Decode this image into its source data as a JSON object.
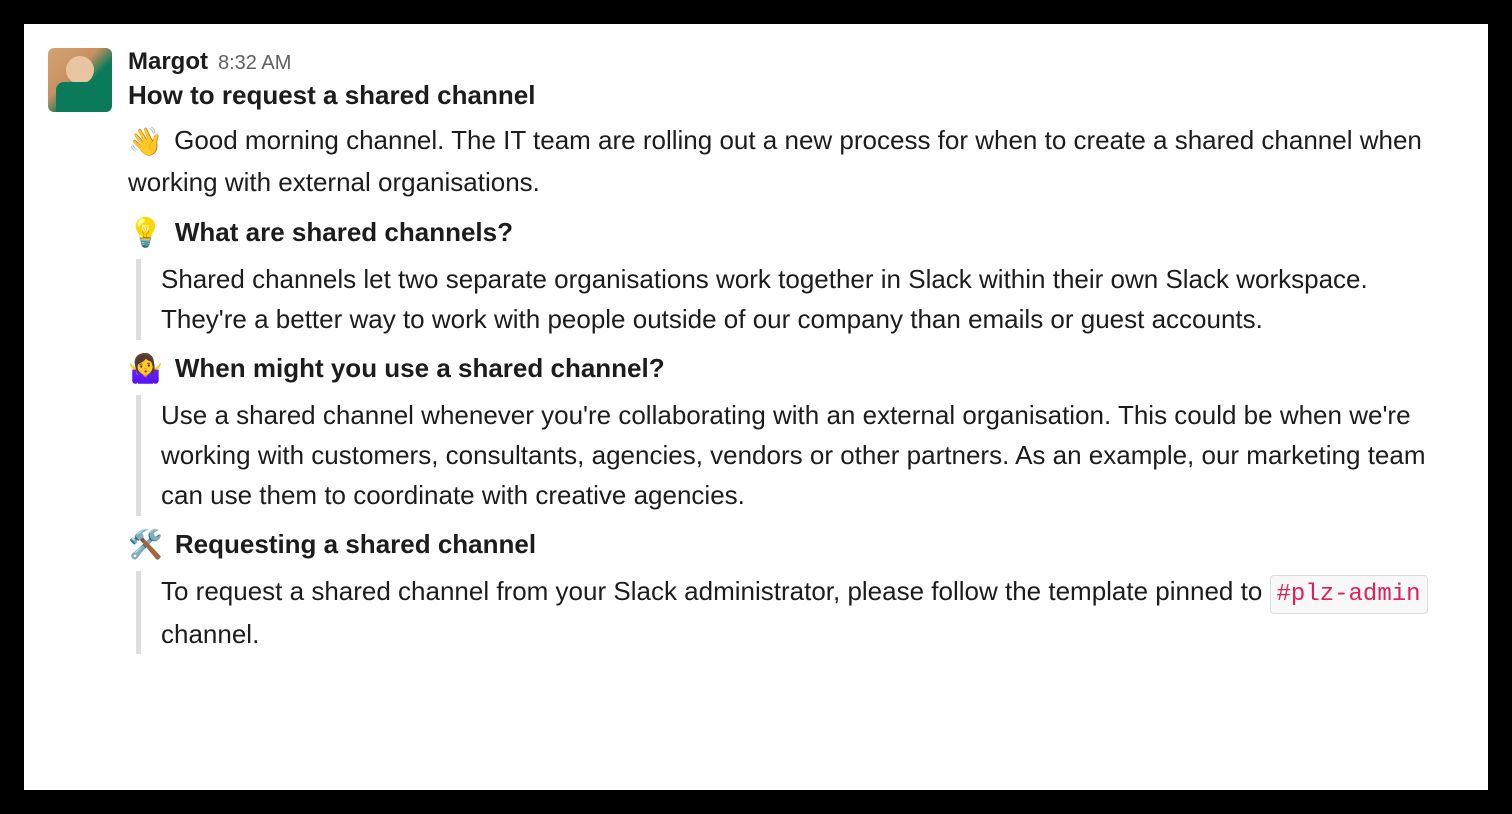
{
  "message": {
    "username": "Margot",
    "timestamp": "8:32 AM",
    "title": "How to request a shared channel",
    "intro_emoji": "👋",
    "intro_text": " Good morning channel. The IT team are rolling out a new process for when to create a shared channel when working with external organisations.",
    "sections": [
      {
        "emoji": "💡",
        "title": "What are shared channels?",
        "body": "Shared channels let two separate organisations work together in Slack within their own Slack workspace. They're a better way to work with people outside of our company than emails or guest accounts."
      },
      {
        "emoji": "🤷‍♀️",
        "title": "When might you use a shared channel?",
        "body": "Use a shared channel whenever you're collaborating with an external organisation. This could be when we're working with customers, consultants, agencies, vendors or other partners. As an example, our marketing team can use them to coordinate with creative agencies."
      },
      {
        "emoji": "🛠️",
        "title": "Requesting a shared channel",
        "body_prefix": "To request a shared channel from your Slack administrator, please follow the template pinned to ",
        "channel_mention": "#plz-admin",
        "body_suffix": " channel."
      }
    ]
  }
}
